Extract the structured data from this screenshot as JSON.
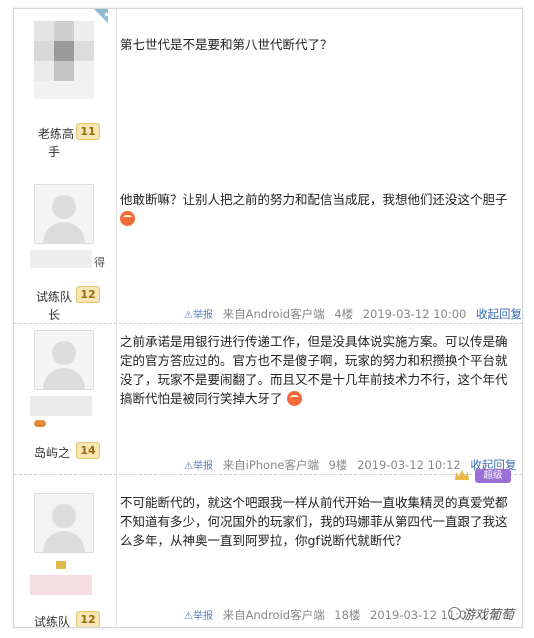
{
  "posts": [
    {
      "rank": "老练高",
      "rank2": "手",
      "level": "11",
      "content": "第七世代是不是要和第八世代断代了？"
    },
    {
      "name_suffix": "得",
      "rank": "试练队",
      "rank2": "长",
      "level": "12",
      "content": "他敢断嘛？让别人把之前的努力和配信当成屁，我想他们还没这个胆子",
      "report": "举报",
      "source": "来自Android客户端",
      "floor": "4楼",
      "time": "2019-03-12 10:00",
      "collapse": "收起回复"
    },
    {
      "rank": "岛屿之",
      "level": "14",
      "content": "之前承诺是用银行进行传递工作，但是没具体说实施方案。可以传是确定的官方答应过的。官方也不是傻子啊，玩家的努力和积攒换个平台就没了，玩家不是要闹翻了。而且又不是十几年前技术力不行，这个年代搞断代怕是被同行笑掉大牙了",
      "report": "举报",
      "source": "来自iPhone客户端",
      "floor": "9楼",
      "time": "2019-03-12 10:12",
      "collapse": "收起回复"
    },
    {
      "rank": "试练队",
      "level": "12",
      "vip": "超级",
      "content": "不可能断代的，就这个吧跟我一样从前代开始一直收集精灵的真爱党都不知道有多少，何况国外的玩家们，我的玛娜菲从第四代一直跟了我这么多年，从神奥一直到阿罗拉，你gf说断代就断代？",
      "report": "举报",
      "source": "来自Android客户端",
      "floor": "18楼",
      "time": "2019-03-12 11:0"
    }
  ],
  "watermark": "游戏葡萄",
  "colors": {
    "link": "#3a6ab6",
    "meta": "#888888",
    "badge": "#f6e6b6",
    "vip": "#9b6fd6",
    "emoji": "#f26a3a"
  }
}
